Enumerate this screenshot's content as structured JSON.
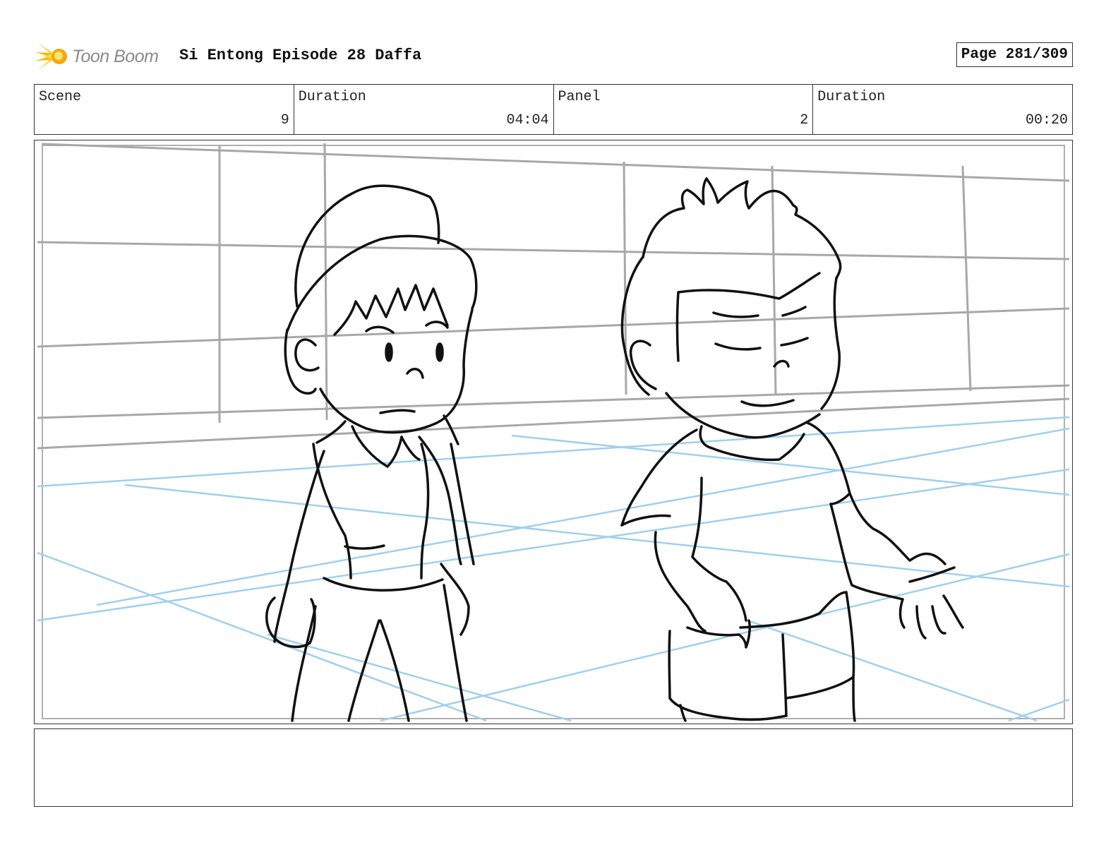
{
  "header": {
    "logo_text": "Toon Boom",
    "project_title": "Si Entong Episode 28 Daffa",
    "page_label": "Page 281/309"
  },
  "info": [
    {
      "label": "Scene",
      "value": "9"
    },
    {
      "label": "Duration",
      "value": "04:04"
    },
    {
      "label": "Panel",
      "value": "2"
    },
    {
      "label": "Duration",
      "value": "00:20"
    }
  ],
  "notes": {
    "text": ""
  },
  "colors": {
    "logo_accent": "#f5b800",
    "grid_gray": "#a8a8a8",
    "guide_blue": "#9fd0ee",
    "ink": "#111111"
  }
}
